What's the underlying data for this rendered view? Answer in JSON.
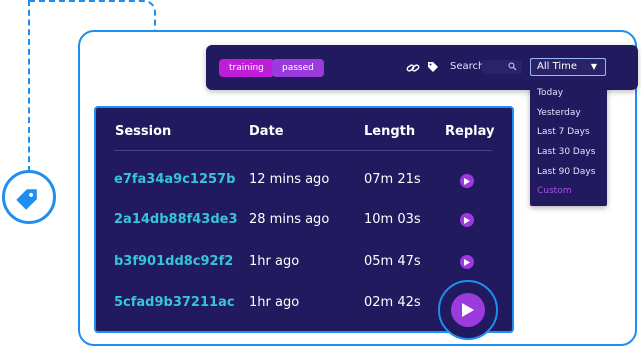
{
  "toolbar": {
    "chips": [
      "training",
      "passed"
    ],
    "search_label": "Search",
    "time_filter": "All Time"
  },
  "dropdown": {
    "options": [
      "Today",
      "Yesterday",
      "Last 7 Days",
      "Last 30 Days",
      "Last 90 Days",
      "Custom"
    ]
  },
  "table": {
    "headers": [
      "Session",
      "Date",
      "Length",
      "Replay"
    ],
    "rows": [
      {
        "session": "e7fa34a9c1257b",
        "date": "12 mins ago",
        "length": "07m 21s"
      },
      {
        "session": "2a14db88f43de3",
        "date": "28 mins ago",
        "length": "10m 03s"
      },
      {
        "session": "b3f901dd8c92f2",
        "date": "1hr ago",
        "length": "05m 47s"
      },
      {
        "session": "5cfad9b37211ac",
        "date": "1hr ago",
        "length": "02m 42s"
      }
    ]
  },
  "colors": {
    "accent_blue": "#1e8ef0",
    "panel": "#221a5e",
    "session_text": "#36c4d9",
    "purple": "#9b3bde",
    "magenta": "#c01dd9"
  }
}
